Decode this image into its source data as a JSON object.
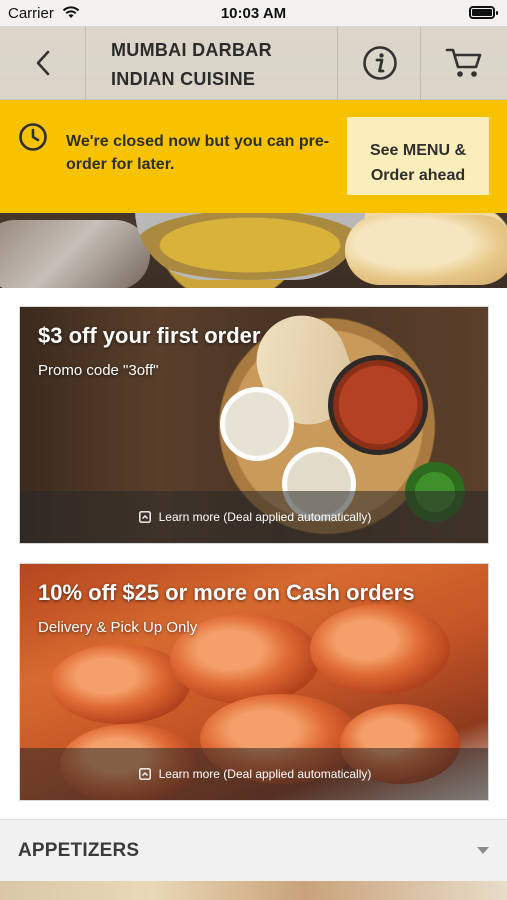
{
  "status_bar": {
    "carrier": "Carrier",
    "time": "10:03 AM"
  },
  "nav": {
    "title_line1": "MUMBAI DARBAR",
    "title_line2": "INDIAN CUISINE",
    "icons": [
      "back-chevron-icon",
      "info-icon",
      "cart-icon"
    ]
  },
  "notice": {
    "message": "We're closed now but you can pre-order for later.",
    "cta_line1": "See MENU &",
    "cta_line2": "Order ahead",
    "background": "#f7c300"
  },
  "deals": [
    {
      "title": "$3 off your first order",
      "subtitle": "Promo code \"3off\"",
      "footer": "Learn more (Deal applied automatically)"
    },
    {
      "title": "10% off $25 or more on Cash orders",
      "subtitle": "Delivery & Pick Up Only",
      "footer": "Learn more (Deal applied automatically)"
    }
  ],
  "menu_sections": [
    {
      "label": "APPETIZERS",
      "expanded": false
    }
  ]
}
